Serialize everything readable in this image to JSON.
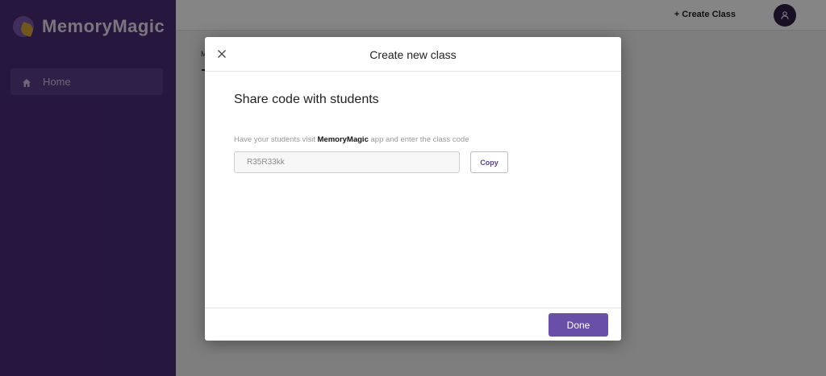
{
  "app": {
    "brand_name": "MemoryMagic",
    "brand_color": "#4a2d7a",
    "accent_color": "#6a4fa8"
  },
  "sidebar": {
    "items": [
      {
        "label": "Home",
        "icon": "home-icon",
        "active": true
      }
    ]
  },
  "topbar": {
    "create_class_label": "+ Create Class",
    "avatar_icon": "user-icon"
  },
  "page": {
    "tab_label": "M"
  },
  "modal": {
    "title": "Create new class",
    "close_icon": "close-icon",
    "section_heading": "Share code with students",
    "instruction_prefix": "Have your students visit ",
    "instruction_app": "MemoryMagic",
    "instruction_suffix": " app and enter the class code",
    "class_code": "R35R33kk",
    "copy_label": "Copy",
    "done_label": "Done"
  }
}
